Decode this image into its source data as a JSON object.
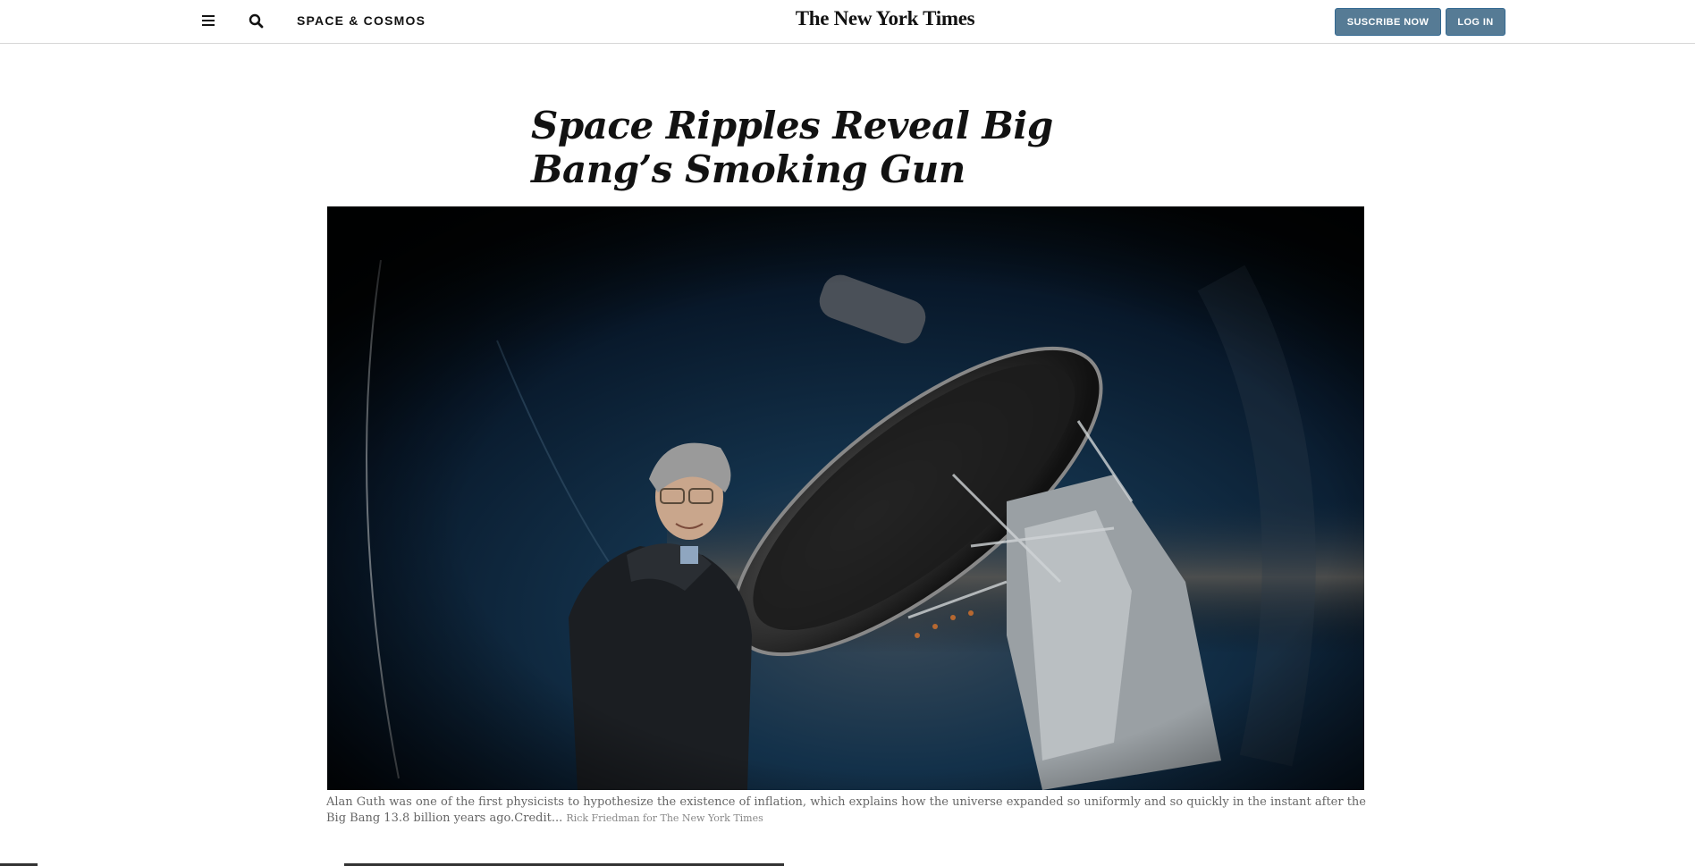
{
  "header": {
    "section": "SPACE & COSMOS",
    "masthead": "The New York Times",
    "subscribe_label": "SUSCRIBE NOW",
    "login_label": "LOG IN",
    "menu_icon": "hamburger-menu-icon",
    "search_icon": "search-icon",
    "button_color": "#567b95"
  },
  "article": {
    "headline": "Space Ripples Reveal Big Bang’s Smoking Gun",
    "image_alt": "Man in dark jacket standing beside a radio telescope at night",
    "caption": "Alan Guth was one of the first physicists to hypothesize the existence of inflation, which explains how the universe expanded so uniformly and so quickly in the instant after the Big Bang 13.8 billion years ago.",
    "credit_prefix": "Credit...",
    "credit": "Rick Friedman for The New York Times"
  }
}
